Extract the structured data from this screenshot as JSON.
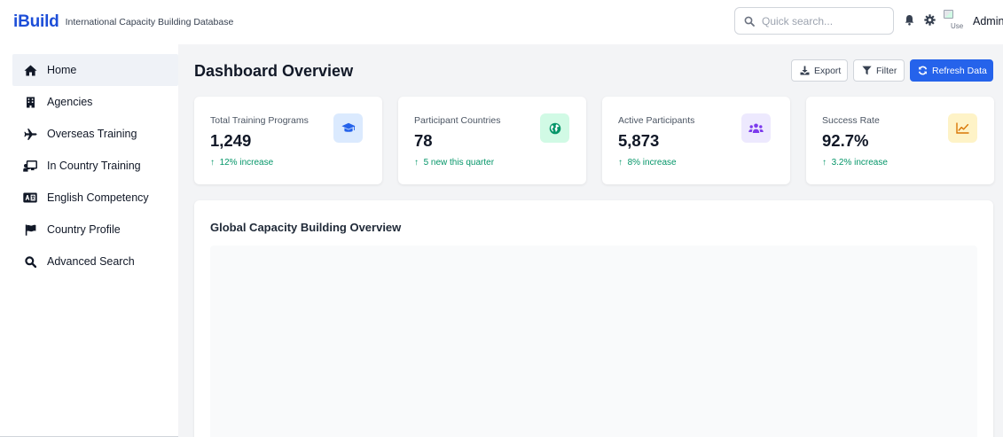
{
  "header": {
    "brand": "iBuild",
    "subtitle": "International Capacity Building Database",
    "search_placeholder": "Quick search...",
    "avatar_alt": "Use",
    "user_name": "Admin",
    "icons": [
      "search-icon",
      "bell-icon",
      "gear-icon"
    ]
  },
  "sidebar": {
    "items": [
      {
        "label": "Home",
        "icon": "home-icon",
        "active": true
      },
      {
        "label": "Agencies",
        "icon": "building-icon",
        "active": false
      },
      {
        "label": "Overseas Training",
        "icon": "plane-icon",
        "active": false
      },
      {
        "label": "In Country Training",
        "icon": "chalkboard-teacher-icon",
        "active": false
      },
      {
        "label": "English Competency",
        "icon": "language-icon",
        "active": false
      },
      {
        "label": "Country Profile",
        "icon": "flag-icon",
        "active": false
      },
      {
        "label": "Advanced Search",
        "icon": "search-icon",
        "active": false
      }
    ]
  },
  "main": {
    "title": "Dashboard Overview",
    "toolbar": {
      "export_label": "Export",
      "filter_label": "Filter",
      "refresh_label": "Refresh Data"
    },
    "stats": [
      {
        "label": "Total Training Programs",
        "value": "1,249",
        "trend": "12% increase",
        "icon": "graduation-cap-icon",
        "icon_bg": "#dbeafe",
        "icon_color": "#2563eb"
      },
      {
        "label": "Participant Countries",
        "value": "78",
        "trend": "5 new this quarter",
        "icon": "globe-icon",
        "icon_bg": "#d1fae5",
        "icon_color": "#059669"
      },
      {
        "label": "Active Participants",
        "value": "5,873",
        "trend": "8% increase",
        "icon": "users-icon",
        "icon_bg": "#ede9fe",
        "icon_color": "#7c3aed"
      },
      {
        "label": "Success Rate",
        "value": "92.7%",
        "trend": "3.2% increase",
        "icon": "chart-line-icon",
        "icon_bg": "#fef3c7",
        "icon_color": "#d97706"
      }
    ],
    "overview": {
      "title": "Global Capacity Building Overview"
    }
  },
  "colors": {
    "accent": "#2563eb",
    "trend_up": "#059669",
    "background": "#f3f4f6"
  }
}
